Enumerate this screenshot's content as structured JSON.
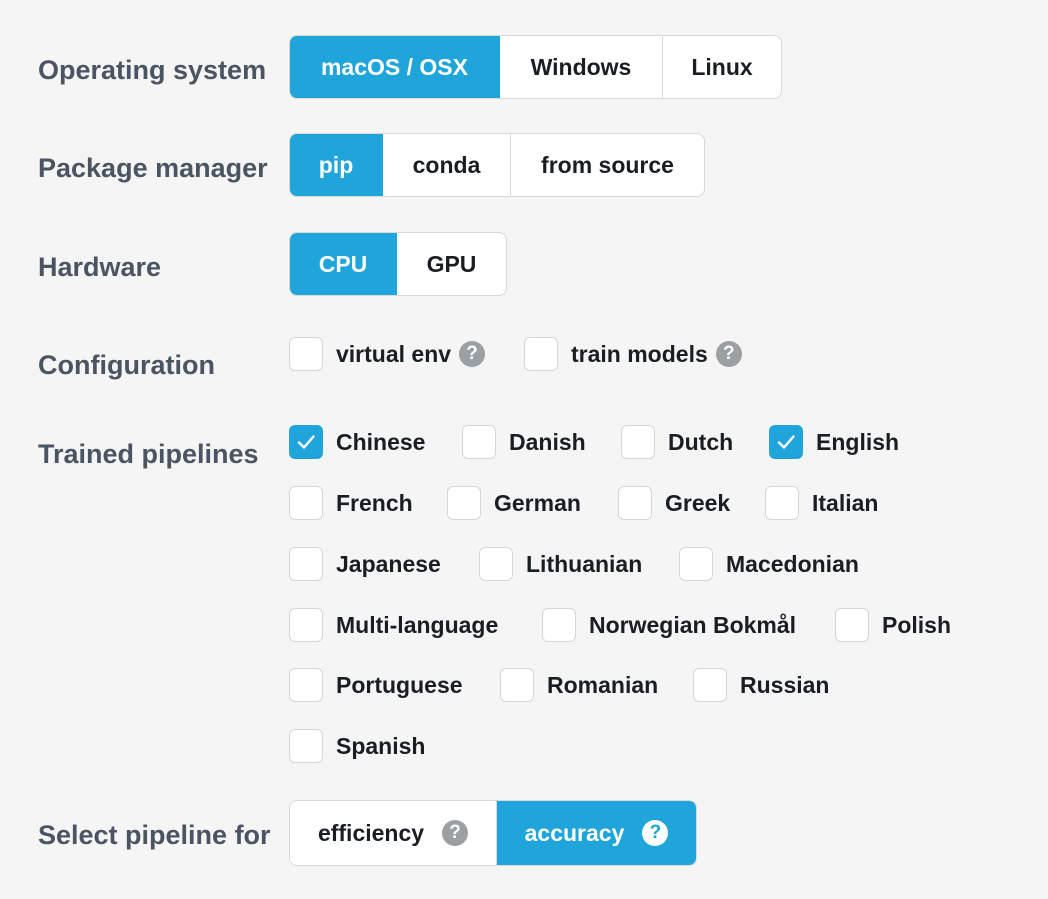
{
  "rows": {
    "os": "Operating system",
    "package": "Package manager",
    "hardware": "Hardware",
    "config": "Configuration",
    "pipelines": "Trained pipelines",
    "select": "Select pipeline for"
  },
  "os_options": [
    "macOS / OSX",
    "Windows",
    "Linux"
  ],
  "package_options": [
    "pip",
    "conda",
    "from source"
  ],
  "hardware_options": [
    "CPU",
    "GPU"
  ],
  "config_options": [
    "virtual env",
    "train models"
  ],
  "languages": [
    "Chinese",
    "Danish",
    "Dutch",
    "English",
    "French",
    "German",
    "Greek",
    "Italian",
    "Japanese",
    "Lithuanian",
    "Macedonian",
    "Multi-language",
    "Norwegian Bokmål",
    "Polish",
    "Portuguese",
    "Romanian",
    "Russian",
    "Spanish"
  ],
  "checked_languages": [
    "Chinese",
    "English"
  ],
  "select_options": [
    "efficiency",
    "accuracy"
  ],
  "selected": {
    "os": "macOS / OSX",
    "package": "pip",
    "hardware": "CPU",
    "select": "accuracy"
  },
  "help_glyph": "?",
  "colors": {
    "accent": "#1fa5da",
    "label": "#4a5462",
    "help": "#9aa0a4"
  }
}
